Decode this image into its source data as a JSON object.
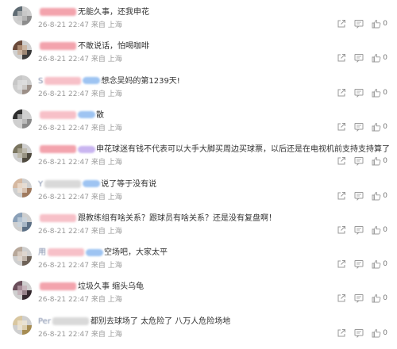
{
  "comments": [
    {
      "username": "",
      "name_style": "blur-red",
      "badge": "",
      "text": "无能久事，还我申花",
      "date": "26-8-21 22:47",
      "location_prefix": "来自",
      "location": "上海",
      "likes": "0"
    },
    {
      "username": "",
      "name_style": "blur-red",
      "badge": "",
      "text": "不敢说话，怕喝咖啡",
      "date": "26-8-21 22:47",
      "location_prefix": "来自",
      "location": "上海",
      "likes": "0"
    },
    {
      "username": "S",
      "name_style": "blur-pink",
      "badge": "blue",
      "text": "想念吴妈的第1239天!",
      "date": "26-8-21 22:47",
      "location_prefix": "来自",
      "location": "上海",
      "likes": "0"
    },
    {
      "username": "",
      "name_style": "blur-pink",
      "badge": "blue",
      "text": "散",
      "date": "26-8-21 22:47",
      "location_prefix": "来自",
      "location": "上海",
      "likes": "0"
    },
    {
      "username": "",
      "name_style": "blur-red",
      "badge": "purple",
      "text": "申花球迷有钱不代表可以大手大脚买周边买球票，以后还是在电视机前支持支持算了",
      "date": "26-8-21 22:47",
      "location_prefix": "来自",
      "location": "上海",
      "likes": "0"
    },
    {
      "username": "Y",
      "name_style": "blur-grey",
      "badge": "blue",
      "text": "说了等于没有说",
      "date": "26-8-21 22:47",
      "location_prefix": "来自",
      "location": "上海",
      "likes": "0"
    },
    {
      "username": "",
      "name_style": "blur-pink",
      "badge": "",
      "text": "跟教练组有啥关系？跟球员有啥关系？还是没有复盘啊！",
      "date": "26-8-21 22:47",
      "location_prefix": "来自",
      "location": "上海",
      "likes": "0"
    },
    {
      "username": "用",
      "name_style": "blur-pink",
      "badge": "blue",
      "text": "空场吧，大家太平",
      "date": "26-8-21 22:47",
      "location_prefix": "来自",
      "location": "上海",
      "likes": "0"
    },
    {
      "username": "",
      "name_style": "blur-red",
      "badge": "",
      "text": "垃圾久事 缩头乌龟",
      "date": "26-8-21 22:47",
      "location_prefix": "来自",
      "location": "上海",
      "likes": "0"
    },
    {
      "username": "Per",
      "name_style": "blur-grey",
      "badge": "",
      "text": "都别去球场了 太危险了 八万人危险场地",
      "date": "26-8-21 22:47",
      "location_prefix": "来自",
      "location": "上海",
      "likes": "0"
    }
  ],
  "actions": {
    "icons": [
      "share-icon",
      "comment-icon",
      "like-icon"
    ]
  },
  "colors": {
    "text": "#333333",
    "meta": "#999999",
    "icon": "#999999",
    "blur_red": "#f3a3ad",
    "blur_blue": "#9ec4f2",
    "blur_purple": "#c9b5f0"
  }
}
